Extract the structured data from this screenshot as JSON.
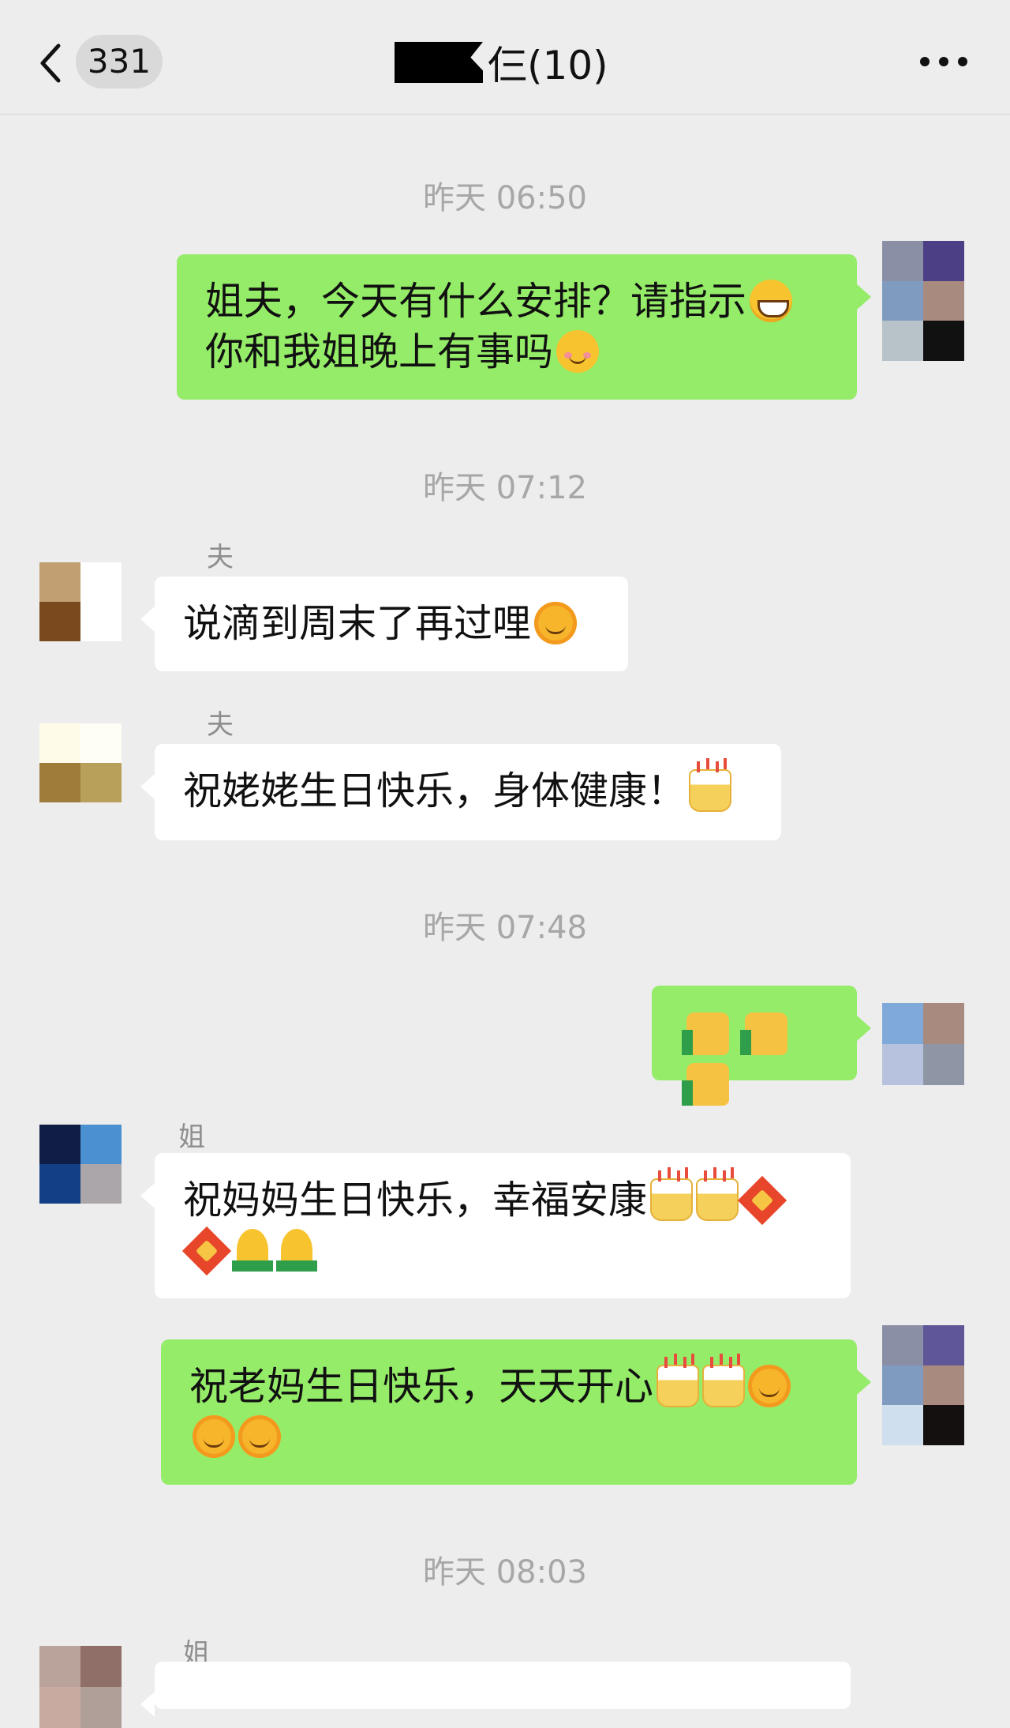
{
  "header": {
    "unread_count": "331",
    "title": "仨(10)"
  },
  "timestamps": {
    "t1": "昨天 06:50",
    "t2": "昨天 07:12",
    "t3": "昨天 07:48",
    "t4": "昨天 08:03"
  },
  "messages": {
    "m1": {
      "line1": "姐夫，今天有什么安排？请指示",
      "line2": "你和我姐晚上有事吗"
    },
    "m2": {
      "sender": "夫",
      "text": "说滴到周末了再过哩"
    },
    "m3": {
      "sender": "夫",
      "text": "祝姥姥生日快乐，身体健康！"
    },
    "m4": {
      "text": ""
    },
    "m5": {
      "sender": "姐",
      "line1": "祝妈妈生日快乐，幸福安康"
    },
    "m6": {
      "line1": "祝老妈生日快乐，天天开心"
    },
    "m7": {
      "sender": "姐"
    }
  },
  "icons": {
    "back": "chevron-left-icon",
    "more": "more-dots-icon",
    "emoji_grin": "grinning-face-icon",
    "emoji_smile": "smiling-face-icon",
    "emoji_sun": "sun-face-icon",
    "emoji_cake": "birthday-cake-icon",
    "emoji_thumb": "thumbs-up-icon",
    "emoji_fu": "fu-blessing-icon",
    "emoji_pray": "praying-hands-icon"
  },
  "colors": {
    "my_bubble": "#95ec69",
    "their_bubble": "#ffffff",
    "background": "#ededed"
  }
}
